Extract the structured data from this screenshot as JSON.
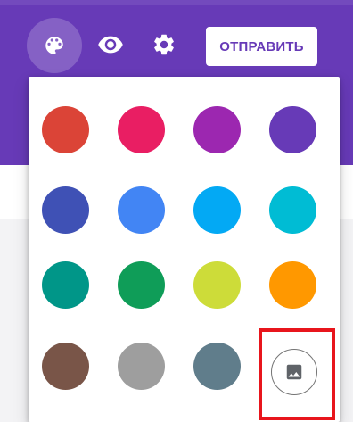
{
  "toolbar": {
    "palette_icon": "palette-icon",
    "preview_icon": "eye-icon",
    "settings_icon": "gear-icon",
    "send_label": "ОТПРАВИТЬ"
  },
  "theme_colors": [
    "#db4437",
    "#e91e63",
    "#9c27b0",
    "#673ab7",
    "#3f51b5",
    "#4285f4",
    "#03a9f4",
    "#00bcd4",
    "#009688",
    "#0f9d58",
    "#cddc39",
    "#ff9800",
    "#795548",
    "#9e9e9e",
    "#607d8b"
  ],
  "image_choice_icon": "image-icon",
  "colors": {
    "header": "#673ab7",
    "highlight": "#e8151c"
  }
}
